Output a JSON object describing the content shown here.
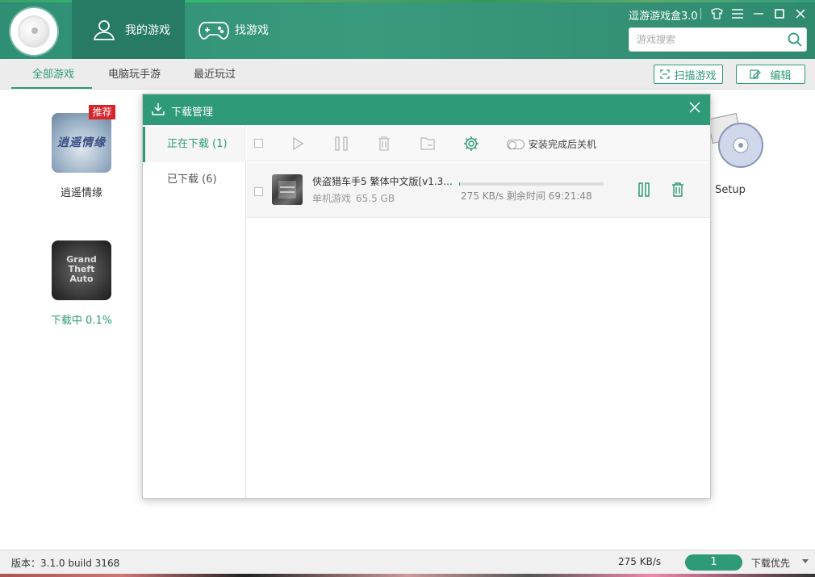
{
  "app": {
    "title": "逗游游戏盒3.0",
    "nav": [
      {
        "label": "我的游戏",
        "icon": "user-icon"
      },
      {
        "label": "找游戏",
        "icon": "gamepad-icon"
      }
    ],
    "search_placeholder": "游戏搜索"
  },
  "subnav": {
    "tabs": [
      "全部游戏",
      "电脑玩手游",
      "最近玩过"
    ],
    "scan_label": "扫描游戏",
    "edit_label": "编辑"
  },
  "games": [
    {
      "name": "逍遥情缘",
      "badge": "推荐",
      "thumb_text": "逍遥情缘"
    },
    {
      "name": "下载中 0.1%",
      "thumb_text": "Grand Theft Auto"
    },
    {
      "name": "Setup"
    }
  ],
  "download_manager": {
    "title": "下载管理",
    "side": [
      "正在下载 (1)",
      "已下载 (6)"
    ],
    "shutdown_label": "安装完成后关机",
    "item": {
      "name": "侠盗猎车手5 繁体中文版[v1.3...",
      "category": "单机游戏",
      "size": "65.5 GB",
      "speed_remaining": "275 KB/s 剩余时间 69:21:48",
      "progress_fraction": 0.001
    }
  },
  "footer": {
    "version": "版本：3.1.0 build 3168",
    "speed": "275 KB/s",
    "count": "1",
    "priority": "下载优先"
  },
  "colors": {
    "accent": "#2e9a78",
    "header": "#3a9a7d",
    "badge": "#d9242b"
  }
}
